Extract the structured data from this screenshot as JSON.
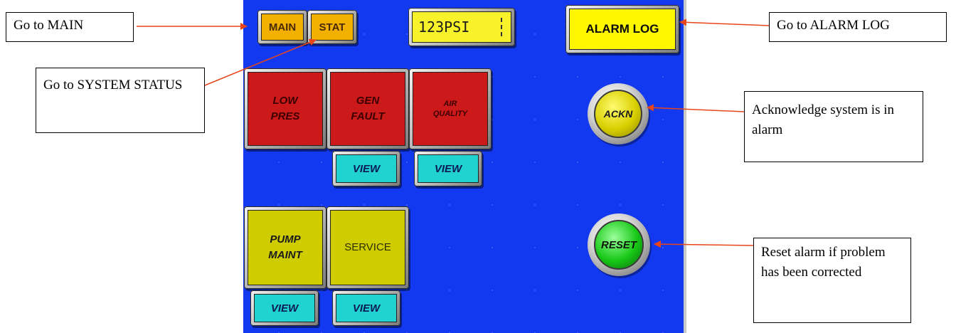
{
  "panel": {
    "nav": {
      "main_label": "MAIN",
      "stat_label": "STAT"
    },
    "pressure_display": "123PSI",
    "alarm_log_label": "ALARM LOG",
    "alarm_tiles": [
      {
        "line1": "LOW",
        "line2": "PRES"
      },
      {
        "line1": "GEN",
        "line2": "FAULT"
      },
      {
        "line1": "AIR",
        "line2": "QUALITY"
      }
    ],
    "status_tiles": [
      {
        "line1": "PUMP",
        "line2": "MAINT"
      },
      {
        "line1": "SERVICE"
      }
    ],
    "view_label": "VIEW",
    "ack_label": "ACKN",
    "reset_label": "RESET",
    "colors": {
      "background": "#1238f0",
      "alarm_tile": "#cc1a1a",
      "status_tile": "#cfcc00",
      "view_button": "#20d2d0",
      "ack_button": "#d9d000",
      "reset_button": "#17c817",
      "arrow": "#e8461a"
    }
  },
  "callouts": {
    "main": "Go to MAIN",
    "system_status": "Go to SYSTEM STATUS",
    "alarm_log": "Go to ALARM LOG",
    "acknowledge": "Acknowledge system is in alarm",
    "reset": "Reset alarm if problem has been corrected"
  }
}
